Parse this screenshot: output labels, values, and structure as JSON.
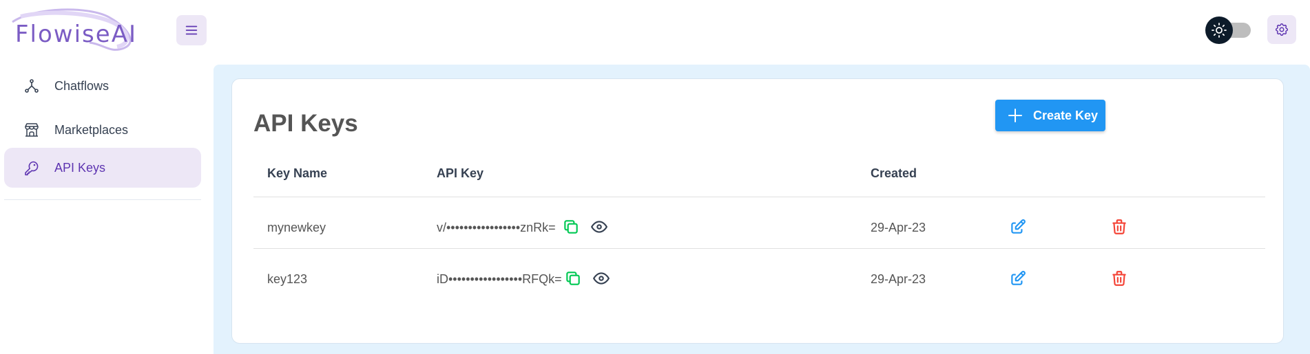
{
  "app": {
    "logo_text": "FlowiseAI"
  },
  "sidebar": {
    "items": [
      {
        "label": "Chatflows",
        "icon": "hierarchy-icon"
      },
      {
        "label": "Marketplaces",
        "icon": "building-store-icon"
      },
      {
        "label": "API Keys",
        "icon": "key-icon",
        "active": true
      }
    ]
  },
  "main": {
    "title": "API Keys",
    "create_button": "Create Key",
    "table": {
      "headers": [
        "Key Name",
        "API Key",
        "Created"
      ],
      "rows": [
        {
          "name": "mynewkey",
          "key": "v/•••••••••••••••••znRk=",
          "created": "29-Apr-23"
        },
        {
          "name": "key123",
          "key": "iD•••••••••••••••••RFQk=",
          "created": "29-Apr-23"
        }
      ]
    }
  },
  "colors": {
    "accent": "#673ab7",
    "primary_button": "#2196f3",
    "copy_icon": "#00c853",
    "edit_icon": "#2196f3",
    "delete_icon": "#f44336",
    "main_bg": "#e3f2fd"
  }
}
